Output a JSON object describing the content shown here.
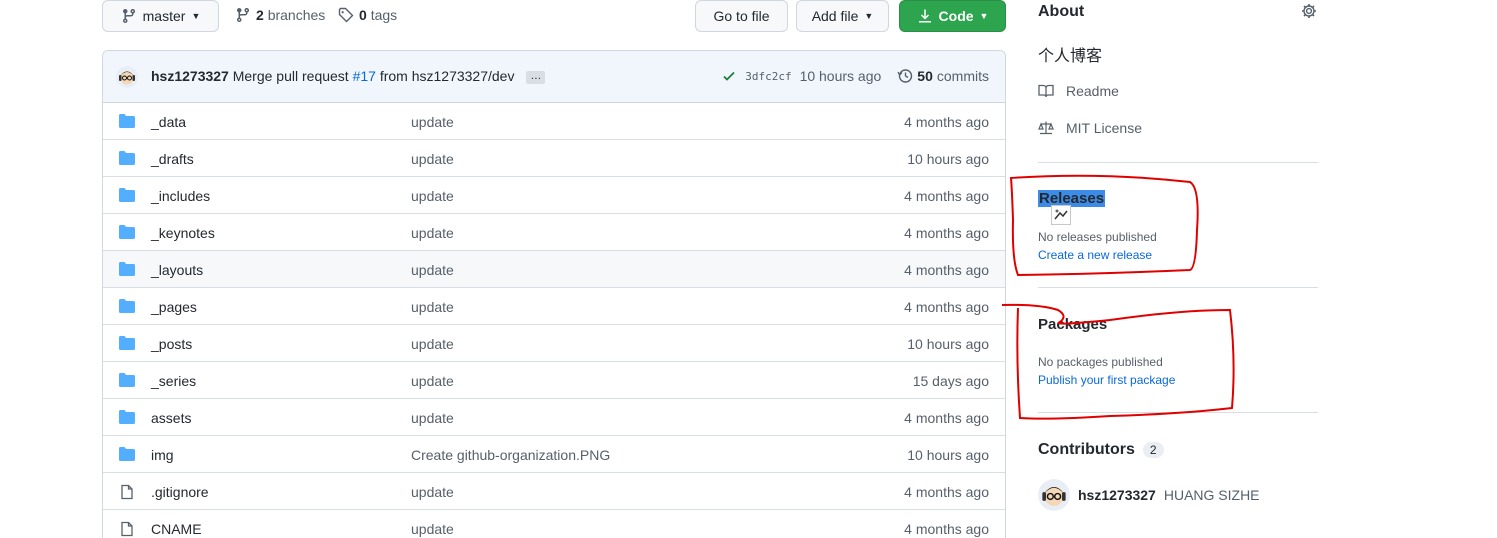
{
  "toolbar": {
    "branch_name": "master",
    "branches_count": "2",
    "branches_label": "branches",
    "tags_count": "0",
    "tags_label": "tags",
    "goto_file_label": "Go to file",
    "add_file_label": "Add file",
    "code_label": "Code"
  },
  "commit": {
    "author": "hsz1273327",
    "message_prefix": "Merge pull request",
    "pr_number": "#17",
    "message_suffix": "from hsz1273327/dev",
    "ellipsis": "…",
    "sha": "3dfc2cf",
    "time": "10 hours ago",
    "commits_count": "50",
    "commits_label": "commits"
  },
  "files": [
    {
      "name": "_data",
      "type": "dir",
      "message": "update",
      "age": "4 months ago"
    },
    {
      "name": "_drafts",
      "type": "dir",
      "message": "update",
      "age": "10 hours ago"
    },
    {
      "name": "_includes",
      "type": "dir",
      "message": "update",
      "age": "4 months ago"
    },
    {
      "name": "_keynotes",
      "type": "dir",
      "message": "update",
      "age": "4 months ago"
    },
    {
      "name": "_layouts",
      "type": "dir",
      "message": "update",
      "age": "4 months ago"
    },
    {
      "name": "_pages",
      "type": "dir",
      "message": "update",
      "age": "4 months ago"
    },
    {
      "name": "_posts",
      "type": "dir",
      "message": "update",
      "age": "10 hours ago"
    },
    {
      "name": "_series",
      "type": "dir",
      "message": "update",
      "age": "15 days ago"
    },
    {
      "name": "assets",
      "type": "dir",
      "message": "update",
      "age": "4 months ago"
    },
    {
      "name": "img",
      "type": "dir",
      "message": "Create github-organization.PNG",
      "age": "10 hours ago"
    },
    {
      "name": ".gitignore",
      "type": "file",
      "message": "update",
      "age": "4 months ago"
    },
    {
      "name": "CNAME",
      "type": "file",
      "message": "update",
      "age": "4 months ago"
    }
  ],
  "sidebar": {
    "about_title": "About",
    "description": "个人博客",
    "readme_label": "Readme",
    "license_label": "MIT License",
    "releases_title": "Releases",
    "no_releases": "No releases published",
    "create_release": "Create a new release",
    "packages_title": "Packages",
    "no_packages": "No packages published",
    "publish_package": "Publish your first package",
    "contributors_title": "Contributors",
    "contributors_count": "2",
    "contributor_login": "hsz1273327",
    "contributor_name": "HUANG SIZHE"
  },
  "colors": {
    "primary_button": "#2da44e",
    "link": "#0969da",
    "folder": "#54aeff",
    "annotation": "#e00000",
    "selection": "#3c8ce7"
  }
}
